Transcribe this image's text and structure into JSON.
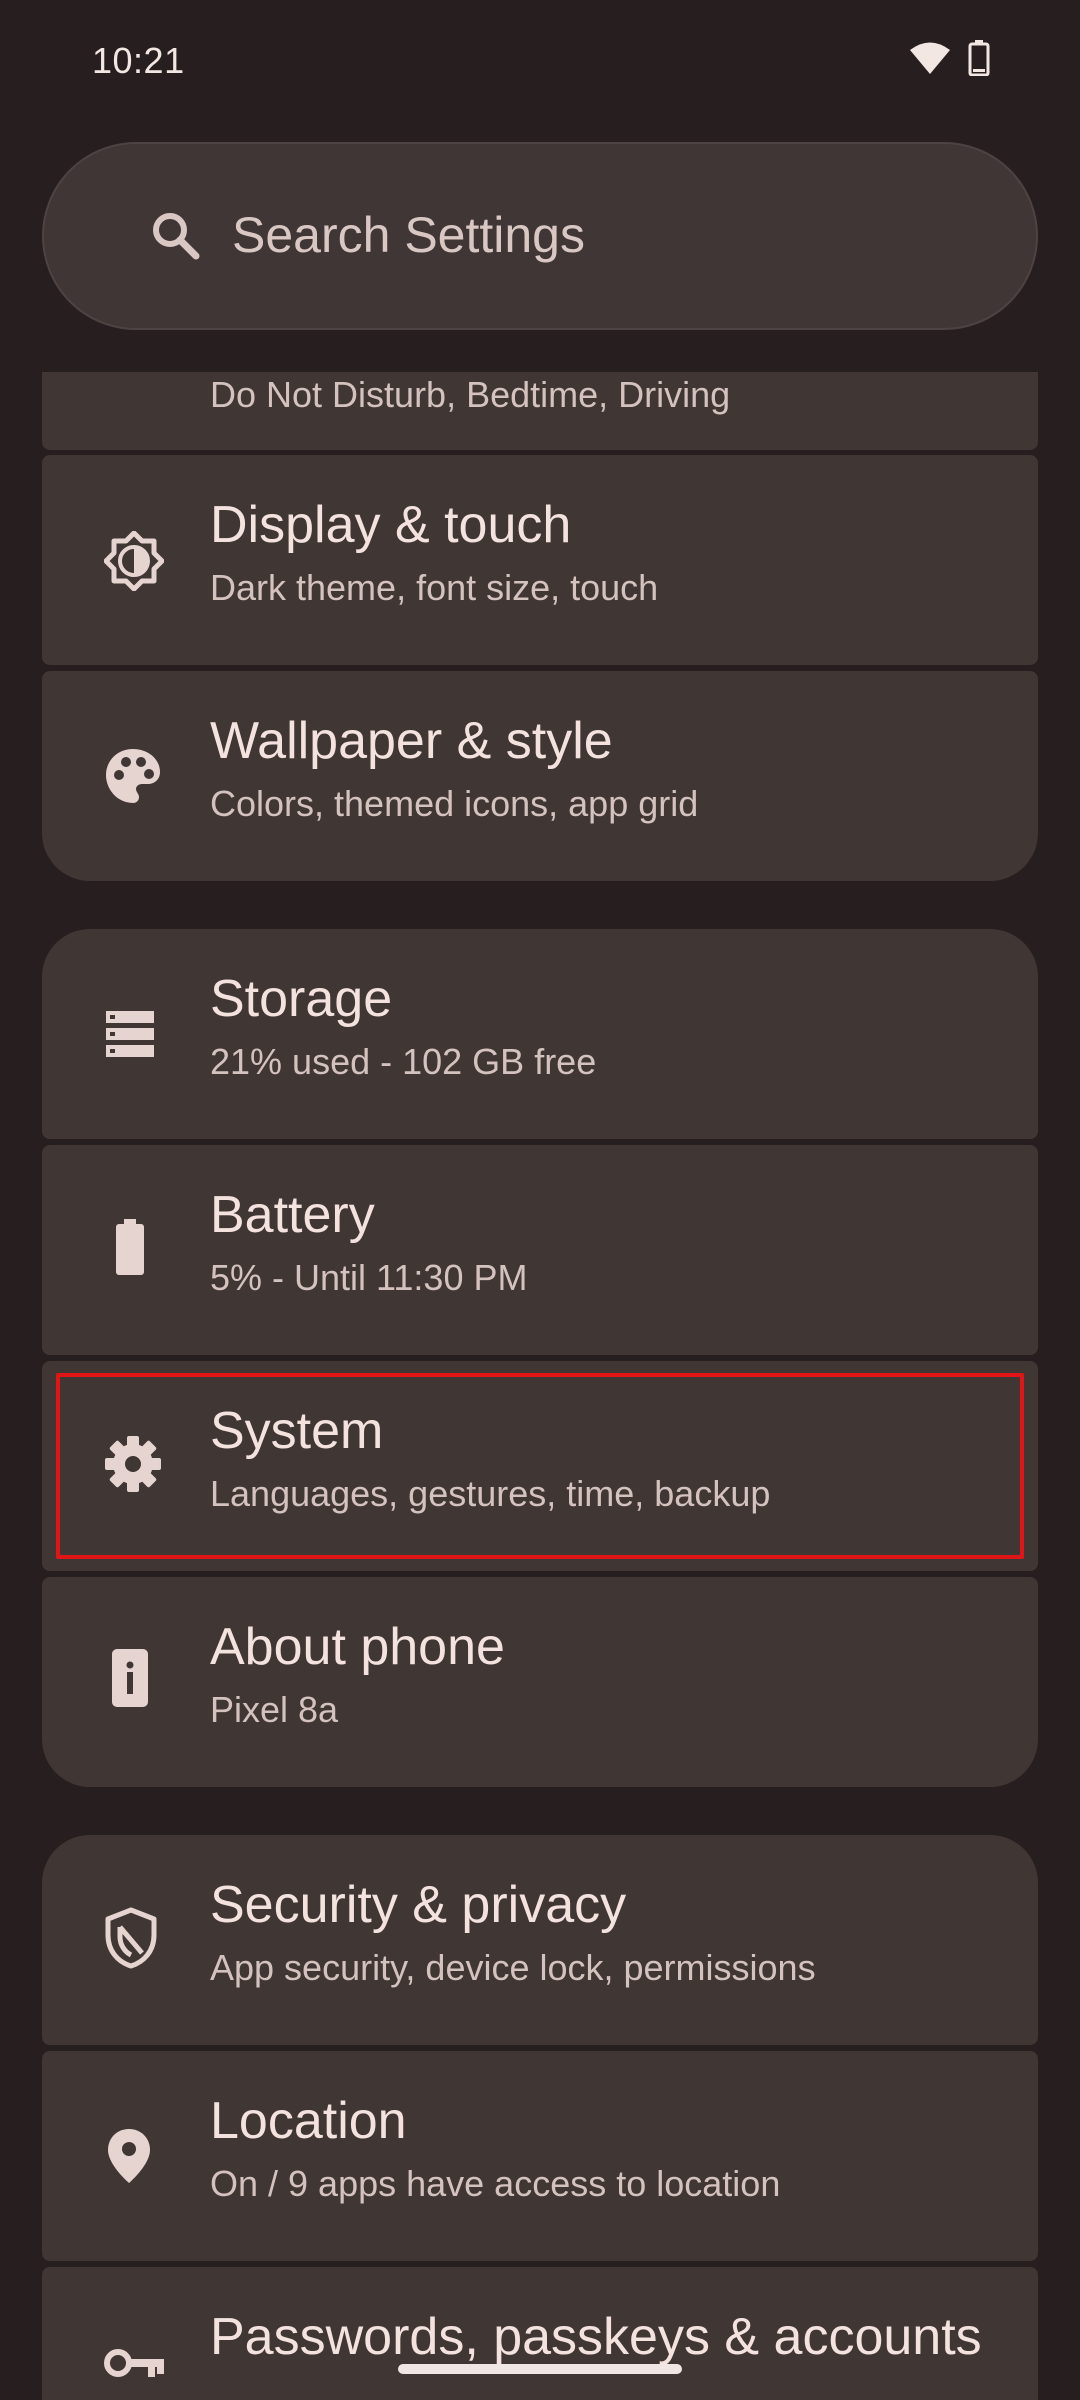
{
  "status_bar": {
    "time": "10:21"
  },
  "search": {
    "placeholder": "Search Settings"
  },
  "items": [
    {
      "key": "modes",
      "title": "",
      "subtitle": "Do Not Disturb, Bedtime, Driving",
      "icon": "modes-icon"
    },
    {
      "key": "display",
      "title": "Display & touch",
      "subtitle": "Dark theme, font size, touch",
      "icon": "brightness-icon"
    },
    {
      "key": "wallpaper",
      "title": "Wallpaper & style",
      "subtitle": "Colors, themed icons, app grid",
      "icon": "palette-icon"
    },
    {
      "key": "storage",
      "title": "Storage",
      "subtitle": "21% used - 102 GB free",
      "icon": "storage-icon"
    },
    {
      "key": "battery",
      "title": "Battery",
      "subtitle": "5% - Until 11:30 PM",
      "icon": "battery-icon"
    },
    {
      "key": "system",
      "title": "System",
      "subtitle": "Languages, gestures, time, backup",
      "icon": "gear-icon",
      "highlighted": true
    },
    {
      "key": "about",
      "title": "About phone",
      "subtitle": "Pixel 8a",
      "icon": "info-icon"
    },
    {
      "key": "security",
      "title": "Security & privacy",
      "subtitle": "App security, device lock, permissions",
      "icon": "shield-icon"
    },
    {
      "key": "location",
      "title": "Location",
      "subtitle": "On / 9 apps have access to location",
      "icon": "location-pin-icon"
    },
    {
      "key": "passwords",
      "title": "Passwords, passkeys & accounts",
      "subtitle": "",
      "icon": "key-icon"
    }
  ],
  "colors": {
    "background": "#271f1f",
    "card": "#403634",
    "highlight": "#e01515"
  }
}
